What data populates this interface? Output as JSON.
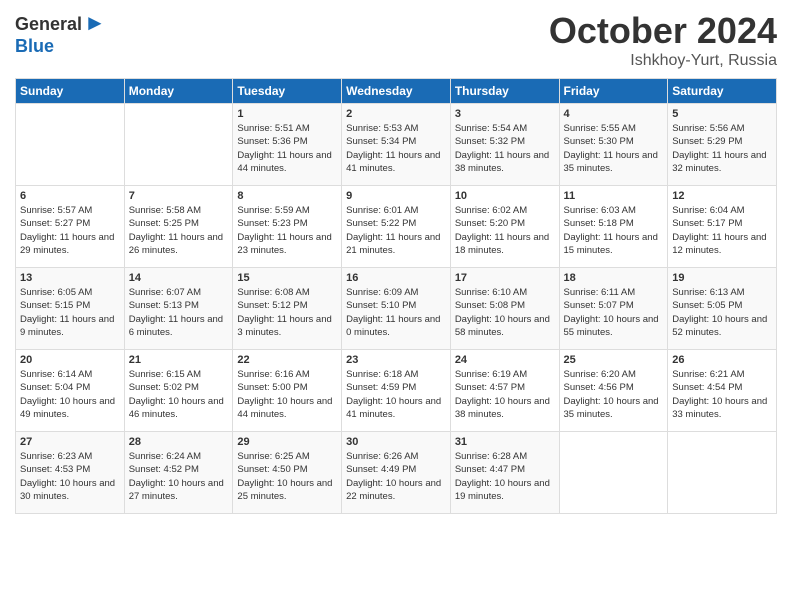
{
  "header": {
    "logo_line1": "General",
    "logo_line2": "Blue",
    "month": "October 2024",
    "location": "Ishkhoy-Yurt, Russia"
  },
  "weekdays": [
    "Sunday",
    "Monday",
    "Tuesday",
    "Wednesday",
    "Thursday",
    "Friday",
    "Saturday"
  ],
  "weeks": [
    [
      {
        "day": "",
        "info": ""
      },
      {
        "day": "",
        "info": ""
      },
      {
        "day": "1",
        "info": "Sunrise: 5:51 AM\nSunset: 5:36 PM\nDaylight: 11 hours and 44 minutes."
      },
      {
        "day": "2",
        "info": "Sunrise: 5:53 AM\nSunset: 5:34 PM\nDaylight: 11 hours and 41 minutes."
      },
      {
        "day": "3",
        "info": "Sunrise: 5:54 AM\nSunset: 5:32 PM\nDaylight: 11 hours and 38 minutes."
      },
      {
        "day": "4",
        "info": "Sunrise: 5:55 AM\nSunset: 5:30 PM\nDaylight: 11 hours and 35 minutes."
      },
      {
        "day": "5",
        "info": "Sunrise: 5:56 AM\nSunset: 5:29 PM\nDaylight: 11 hours and 32 minutes."
      }
    ],
    [
      {
        "day": "6",
        "info": "Sunrise: 5:57 AM\nSunset: 5:27 PM\nDaylight: 11 hours and 29 minutes."
      },
      {
        "day": "7",
        "info": "Sunrise: 5:58 AM\nSunset: 5:25 PM\nDaylight: 11 hours and 26 minutes."
      },
      {
        "day": "8",
        "info": "Sunrise: 5:59 AM\nSunset: 5:23 PM\nDaylight: 11 hours and 23 minutes."
      },
      {
        "day": "9",
        "info": "Sunrise: 6:01 AM\nSunset: 5:22 PM\nDaylight: 11 hours and 21 minutes."
      },
      {
        "day": "10",
        "info": "Sunrise: 6:02 AM\nSunset: 5:20 PM\nDaylight: 11 hours and 18 minutes."
      },
      {
        "day": "11",
        "info": "Sunrise: 6:03 AM\nSunset: 5:18 PM\nDaylight: 11 hours and 15 minutes."
      },
      {
        "day": "12",
        "info": "Sunrise: 6:04 AM\nSunset: 5:17 PM\nDaylight: 11 hours and 12 minutes."
      }
    ],
    [
      {
        "day": "13",
        "info": "Sunrise: 6:05 AM\nSunset: 5:15 PM\nDaylight: 11 hours and 9 minutes."
      },
      {
        "day": "14",
        "info": "Sunrise: 6:07 AM\nSunset: 5:13 PM\nDaylight: 11 hours and 6 minutes."
      },
      {
        "day": "15",
        "info": "Sunrise: 6:08 AM\nSunset: 5:12 PM\nDaylight: 11 hours and 3 minutes."
      },
      {
        "day": "16",
        "info": "Sunrise: 6:09 AM\nSunset: 5:10 PM\nDaylight: 11 hours and 0 minutes."
      },
      {
        "day": "17",
        "info": "Sunrise: 6:10 AM\nSunset: 5:08 PM\nDaylight: 10 hours and 58 minutes."
      },
      {
        "day": "18",
        "info": "Sunrise: 6:11 AM\nSunset: 5:07 PM\nDaylight: 10 hours and 55 minutes."
      },
      {
        "day": "19",
        "info": "Sunrise: 6:13 AM\nSunset: 5:05 PM\nDaylight: 10 hours and 52 minutes."
      }
    ],
    [
      {
        "day": "20",
        "info": "Sunrise: 6:14 AM\nSunset: 5:04 PM\nDaylight: 10 hours and 49 minutes."
      },
      {
        "day": "21",
        "info": "Sunrise: 6:15 AM\nSunset: 5:02 PM\nDaylight: 10 hours and 46 minutes."
      },
      {
        "day": "22",
        "info": "Sunrise: 6:16 AM\nSunset: 5:00 PM\nDaylight: 10 hours and 44 minutes."
      },
      {
        "day": "23",
        "info": "Sunrise: 6:18 AM\nSunset: 4:59 PM\nDaylight: 10 hours and 41 minutes."
      },
      {
        "day": "24",
        "info": "Sunrise: 6:19 AM\nSunset: 4:57 PM\nDaylight: 10 hours and 38 minutes."
      },
      {
        "day": "25",
        "info": "Sunrise: 6:20 AM\nSunset: 4:56 PM\nDaylight: 10 hours and 35 minutes."
      },
      {
        "day": "26",
        "info": "Sunrise: 6:21 AM\nSunset: 4:54 PM\nDaylight: 10 hours and 33 minutes."
      }
    ],
    [
      {
        "day": "27",
        "info": "Sunrise: 6:23 AM\nSunset: 4:53 PM\nDaylight: 10 hours and 30 minutes."
      },
      {
        "day": "28",
        "info": "Sunrise: 6:24 AM\nSunset: 4:52 PM\nDaylight: 10 hours and 27 minutes."
      },
      {
        "day": "29",
        "info": "Sunrise: 6:25 AM\nSunset: 4:50 PM\nDaylight: 10 hours and 25 minutes."
      },
      {
        "day": "30",
        "info": "Sunrise: 6:26 AM\nSunset: 4:49 PM\nDaylight: 10 hours and 22 minutes."
      },
      {
        "day": "31",
        "info": "Sunrise: 6:28 AM\nSunset: 4:47 PM\nDaylight: 10 hours and 19 minutes."
      },
      {
        "day": "",
        "info": ""
      },
      {
        "day": "",
        "info": ""
      }
    ]
  ]
}
